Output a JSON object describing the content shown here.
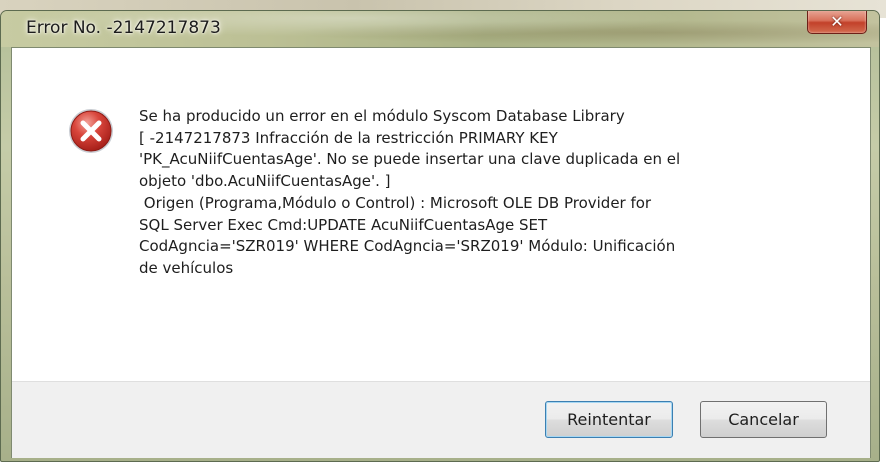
{
  "window": {
    "title": "Error No. -2147217873",
    "close_glyph": "✕"
  },
  "dialog": {
    "icon": "error-icon",
    "message_lines": [
      "Se ha producido un error en el módulo Syscom Database Library",
      "[ -2147217873  Infracción de la restricción PRIMARY KEY",
      "'PK_AcuNiifCuentasAge'. No se puede insertar una clave duplicada en el",
      "objeto 'dbo.AcuNiifCuentasAge'. ]",
      " Origen (Programa,Módulo o Control) : Microsoft OLE DB Provider for",
      "SQL Server Exec Cmd:UPDATE AcuNiifCuentasAge SET",
      "CodAgncia='SZR019' WHERE CodAgncia='SRZ019' Módulo: Unificación",
      "de vehículos"
    ]
  },
  "buttons": {
    "retry_label": "Reintentar",
    "cancel_label": "Cancelar"
  },
  "colors": {
    "error_icon_red": "#c8322a",
    "default_button_border": "#3c7fb1",
    "close_button_red": "#c2412a"
  }
}
